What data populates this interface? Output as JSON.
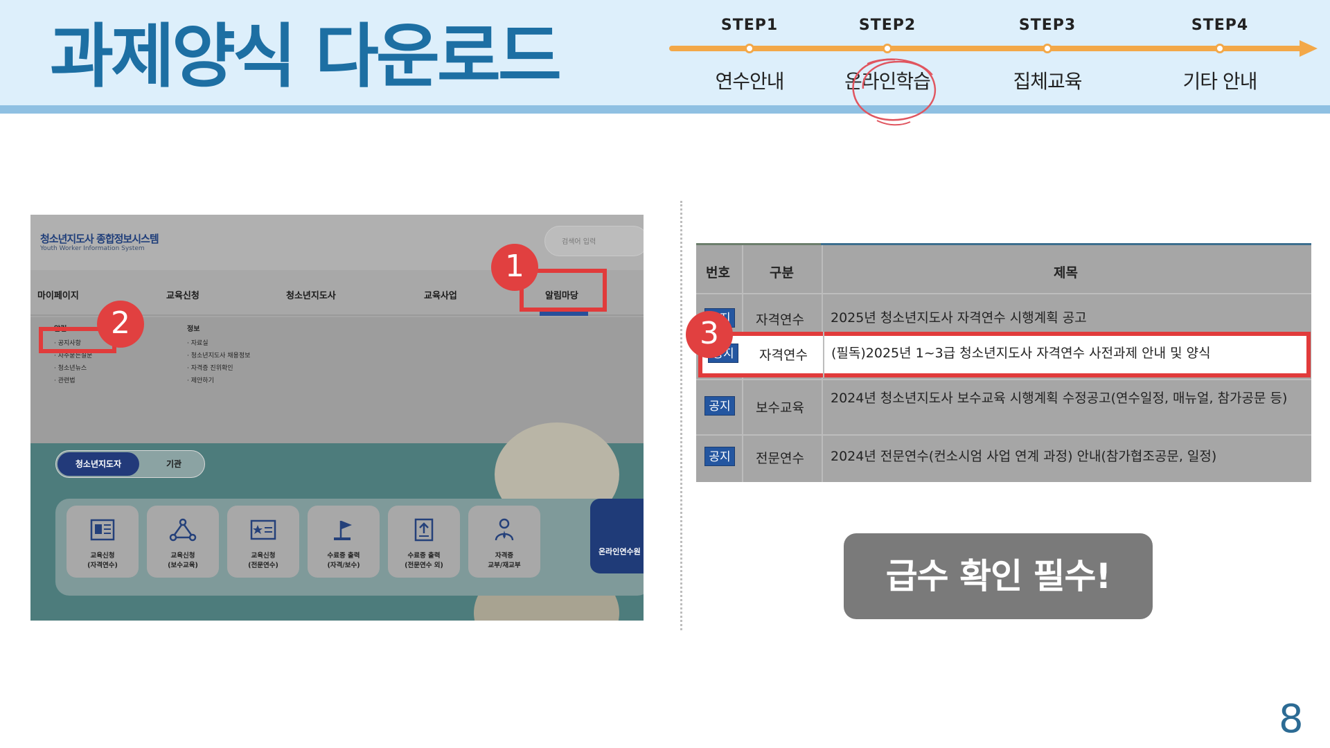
{
  "slide": {
    "title": "과제양식 다운로드",
    "page_number": "8",
    "notice_button": "급수 확인 필수!"
  },
  "timeline": {
    "accent_color": "#f3a848",
    "current_step": 2,
    "steps": [
      {
        "label": "STEP1",
        "name": "연수안내"
      },
      {
        "label": "STEP2",
        "name": "온라인학습"
      },
      {
        "label": "STEP3",
        "name": "집체교육"
      },
      {
        "label": "STEP4",
        "name": "기타 안내"
      }
    ]
  },
  "website": {
    "logo_title": "청소년지도사 종합정보시스템",
    "logo_subtitle": "Youth Worker Information System",
    "search_placeholder": "검색어 입력",
    "nav": [
      "마이페이지",
      "교육신청",
      "청소년지도사",
      "교육사업",
      "알림마당"
    ],
    "dropdown": {
      "col1_head": "알림",
      "col1_items": [
        "공지사항",
        "자주묻는질문",
        "청소년뉴스",
        "관련법"
      ],
      "col2_head": "정보",
      "col2_items": [
        "자료실",
        "청소년지도사 채용정보",
        "자격증 진위확인",
        "제안하기"
      ]
    },
    "toggle": {
      "active": "청소년지도자",
      "inactive": "기관"
    },
    "tiles": [
      {
        "icon": "document-icon",
        "label": "교육신청\n(자격연수)"
      },
      {
        "icon": "network-icon",
        "label": "교육신청\n(보수교육)"
      },
      {
        "icon": "certificate-icon",
        "label": "교육신청\n(전문연수)"
      },
      {
        "icon": "flag-icon",
        "label": "수료증 출력\n(자격/보수)"
      },
      {
        "icon": "upload-doc-icon",
        "label": "수료증 출력\n(전문연수 외)"
      },
      {
        "icon": "person-icon",
        "label": "자격증\n교부/재교부"
      }
    ],
    "big_tile": "온라인연수원"
  },
  "markers": [
    "1",
    "2",
    "3"
  ],
  "board": {
    "headers": [
      "번호",
      "구분",
      "제목"
    ],
    "rows": [
      {
        "tag": "공지",
        "category": "자격연수",
        "subject": "2025년 청소년지도사 자격연수 시행계획 공고"
      },
      {
        "tag": "공지",
        "category": "자격연수",
        "subject": "(필독)2025년 1~3급 청소년지도사 자격연수 사전과제 안내 및 양식"
      },
      {
        "tag": "공지",
        "category": "보수교육",
        "subject": "2024년 청소년지도사 보수교육 시행계획 수정공고(연수일정, 매뉴얼, 참가공문 등)"
      },
      {
        "tag": "공지",
        "category": "전문연수",
        "subject": "2024년 전문연수(컨소시엄 사업 연계 과정) 안내(참가협조공문, 일정)"
      }
    ]
  }
}
